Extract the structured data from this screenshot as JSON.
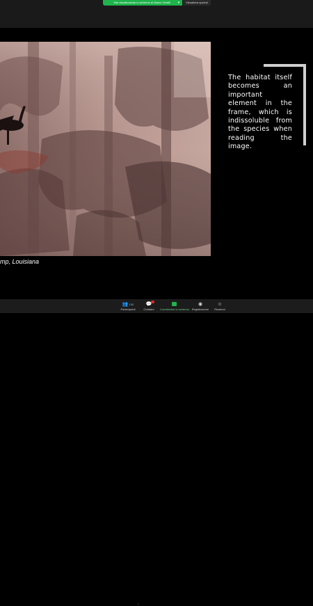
{
  "top_bar": {
    "share_notice": "Stai visualizzando lo schermo di Marco Gentili",
    "view_options": "Visualizza opzioni",
    "chevron": "▾"
  },
  "slide": {
    "caption": "mp, Louisiana",
    "quote": "The habitat itself becomes an important element in the frame, which is indissoluble from the species when reading the image."
  },
  "toolbar": {
    "participants": {
      "label": "Partecipanti",
      "count": "150",
      "icon": "people-icon"
    },
    "chat": {
      "label": "Chattare",
      "icon": "chat-icon"
    },
    "share": {
      "label": "Condividere lo schermo",
      "icon": "share-screen-icon"
    },
    "record": {
      "label": "Registrazione",
      "icon": "record-icon"
    },
    "reactions": {
      "label": "Reazioni",
      "icon": "reactions-icon"
    }
  },
  "colors": {
    "accent_green": "#1fb34b",
    "bracket": "#cfcfcf",
    "badge_red": "#e02828"
  }
}
